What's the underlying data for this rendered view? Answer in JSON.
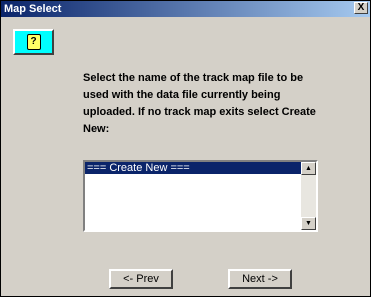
{
  "window": {
    "title": "Map Select",
    "close_glyph": "X"
  },
  "help": {
    "glyph": "?",
    "icon": "help-icon"
  },
  "instruction": {
    "text": "Select the name of the track map file to be used with the data file currently being uploaded. If no track map exits select Create New:"
  },
  "track_map_list": {
    "items": [
      {
        "label": "=== Create New ===",
        "selected": true
      }
    ]
  },
  "buttons": {
    "prev_label": "<- Prev",
    "next_label": "Next ->"
  },
  "colors": {
    "window_bg": "#d4d0c8",
    "title_gradient_start": "#0a246a",
    "title_gradient_end": "#a6caf0",
    "help_button_bg": "#00ffff",
    "selection_bg": "#0a246a"
  }
}
